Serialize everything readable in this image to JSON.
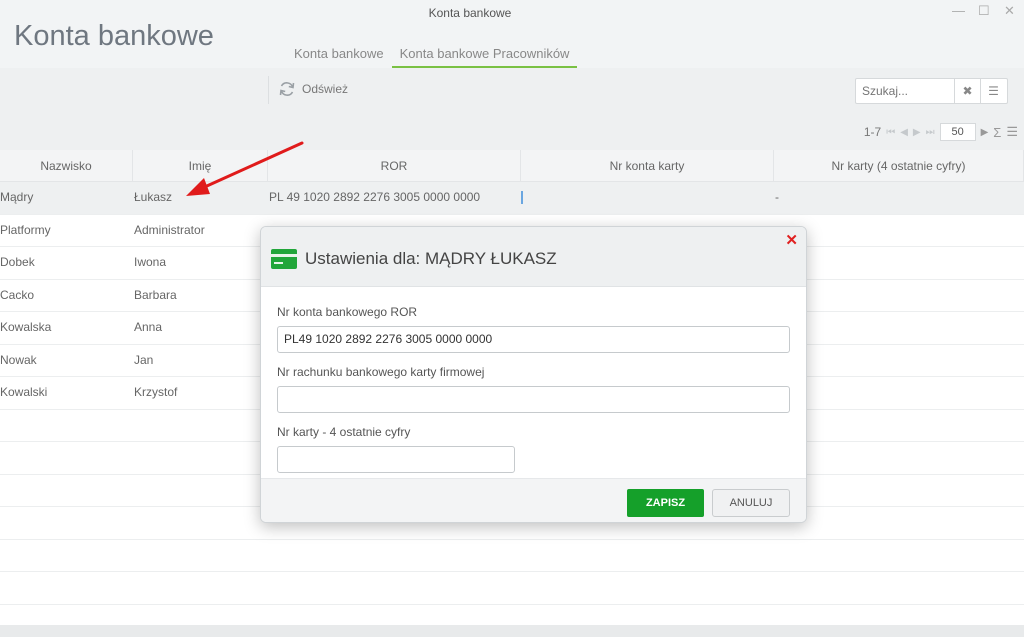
{
  "window": {
    "title": "Konta bankowe",
    "minimize": "—",
    "maximize": "☐",
    "close": "✕"
  },
  "page": {
    "title": "Konta bankowe"
  },
  "tabs": [
    {
      "label": "Konta bankowe",
      "active": false
    },
    {
      "label": "Konta bankowe Pracowników",
      "active": true
    }
  ],
  "toolbar": {
    "refresh_label": "Odśwież",
    "search_placeholder": "Szukaj..."
  },
  "pager": {
    "range": "1-7",
    "page_size": "50"
  },
  "grid": {
    "columns": [
      "Nazwisko",
      "Imię",
      "ROR",
      "Nr konta karty",
      "Nr karty (4 ostatnie cyfry)"
    ],
    "rows": [
      {
        "nazwisko": "Mądry",
        "imie": "Łukasz",
        "ror": "PL 49 1020 2892 2276 3005 0000 0000",
        "nr_karty": "-"
      },
      {
        "nazwisko": "Platformy",
        "imie": "Administrator",
        "ror": "",
        "nr_karty": ""
      },
      {
        "nazwisko": "Dobek",
        "imie": "Iwona",
        "ror": "",
        "nr_karty": ""
      },
      {
        "nazwisko": "Cacko",
        "imie": "Barbara",
        "ror": "",
        "nr_karty": ""
      },
      {
        "nazwisko": "Kowalska",
        "imie": "Anna",
        "ror": "",
        "nr_karty": ""
      },
      {
        "nazwisko": "Nowak",
        "imie": "Jan",
        "ror": "",
        "nr_karty": ""
      },
      {
        "nazwisko": "Kowalski",
        "imie": "Krzystof",
        "ror": "",
        "nr_karty": ""
      }
    ]
  },
  "dialog": {
    "title": "Ustawienia dla: MĄDRY ŁUKASZ",
    "close": "✕",
    "fields": [
      {
        "label": "Nr konta bankowego ROR",
        "value": "PL49 1020 2892 2276 3005 0000 0000"
      },
      {
        "label": "Nr rachunku bankowego karty firmowej",
        "value": ""
      },
      {
        "label": "Nr karty - 4 ostatnie cyfry",
        "value": ""
      }
    ],
    "save_label": "ZAPISZ",
    "cancel_label": "ANULUJ"
  },
  "colors": {
    "accent_green": "#15a02a",
    "tab_underline": "#7ac143",
    "arrow_red": "#e01b1b"
  }
}
